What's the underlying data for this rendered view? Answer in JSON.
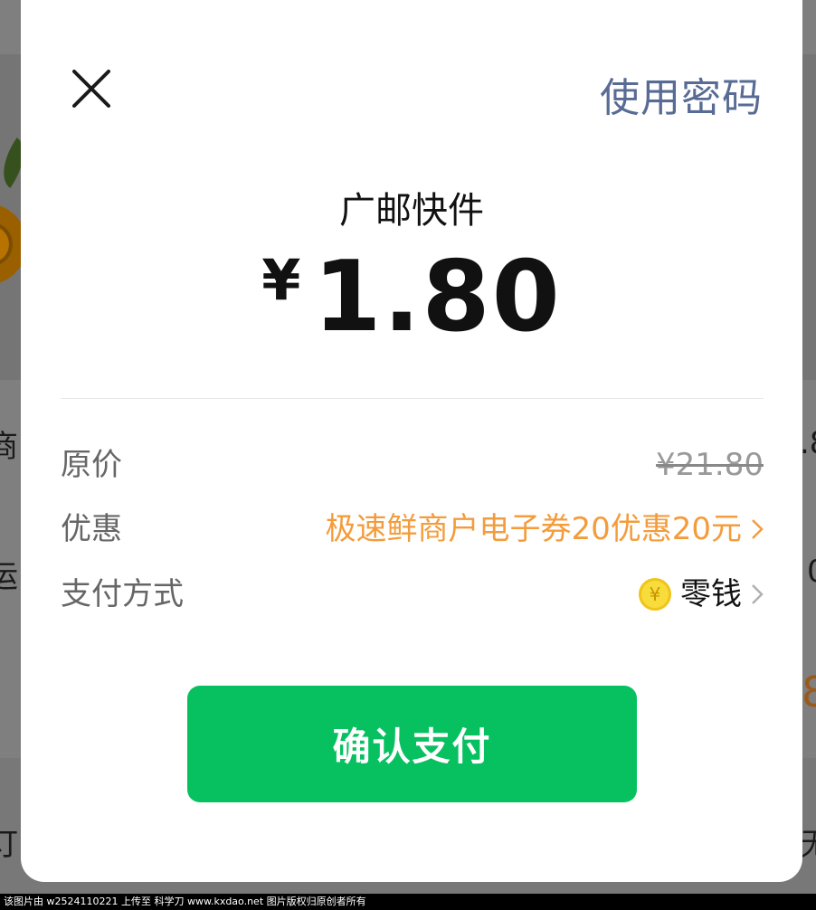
{
  "background": {
    "fragments": {
      "left_1": "商",
      "left_2": "运",
      "left_3": "订",
      "right_1": ".8",
      "right_2": "0",
      "right_3": "8",
      "right_4": "无"
    }
  },
  "header": {
    "close_icon": "close-icon",
    "use_password_label": "使用密码"
  },
  "payment": {
    "merchant_name": "广邮快件",
    "currency_symbol": "¥",
    "amount": "1.80"
  },
  "details": {
    "original_label": "原价",
    "original_value": "¥21.80",
    "discount_label": "优惠",
    "discount_value": "极速鲜商户电子券20优惠20元",
    "payment_method_label": "支付方式",
    "payment_method_value": "零钱",
    "payment_method_icon": "coin-icon",
    "coin_symbol": "¥"
  },
  "confirm_button_label": "确认支付",
  "colors": {
    "accent_green": "#07c160",
    "link_blue": "#576b95",
    "discount_orange": "#f49c3c"
  },
  "watermark": "该图片由 w2524110221 上传至 科学刀 www.kxdao.net 图片版权归原创者所有"
}
